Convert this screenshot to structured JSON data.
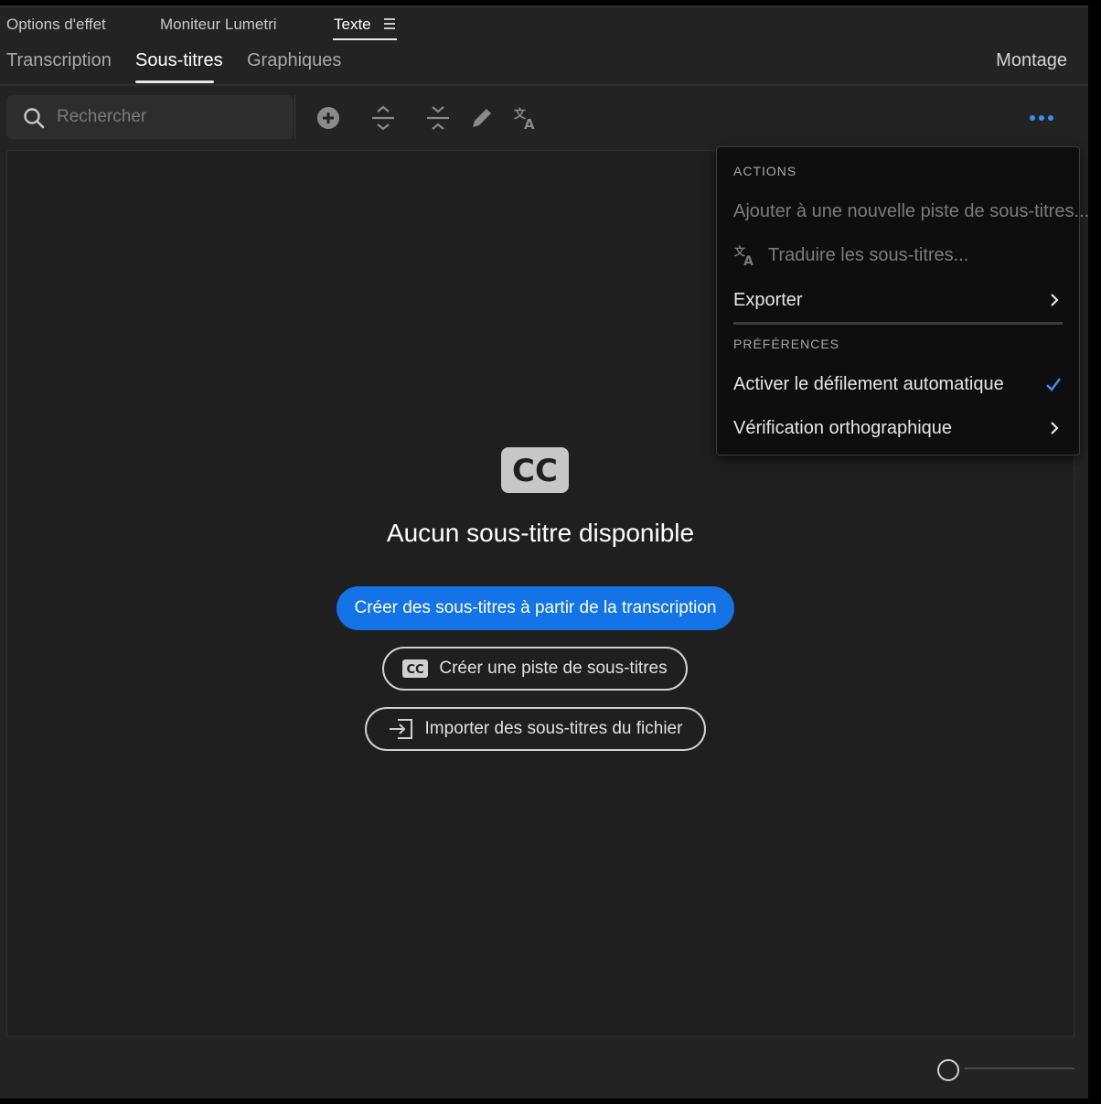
{
  "panel_tabs": [
    {
      "label": "Options d'effet"
    },
    {
      "label": "Moniteur Lumetri"
    },
    {
      "label": "Texte"
    }
  ],
  "sub_tabs": [
    {
      "label": "Transcription"
    },
    {
      "label": "Sous-titres"
    },
    {
      "label": "Graphiques"
    }
  ],
  "workspace": {
    "label": "Montage"
  },
  "search": {
    "placeholder": "Rechercher"
  },
  "toolbar": {
    "icons": [
      "add-caption-icon",
      "split-caption-icon",
      "merge-caption-icon",
      "edit-icon",
      "translate-icon",
      "more-icon"
    ]
  },
  "empty_state": {
    "title": "Aucun sous-titre disponible",
    "primary_button": "Créer des sous-titres à partir de la transcription",
    "track_button": "Créer une piste de sous-titres",
    "import_button": "Importer des sous-titres du fichier"
  },
  "menu": {
    "actions_header": "ACTIONS",
    "add_to_track": "Ajouter à une nouvelle piste de sous-titres...",
    "translate": "Traduire les sous-titres...",
    "export": "Exporter",
    "preferences_header": "PRÉFÉRENCES",
    "auto_scroll": "Activer le défilement automatique",
    "spell_check": "Vérification orthographique"
  },
  "colors": {
    "accent": "#1473e6",
    "check": "#3b8ef0",
    "panel_bg": "#232323"
  }
}
